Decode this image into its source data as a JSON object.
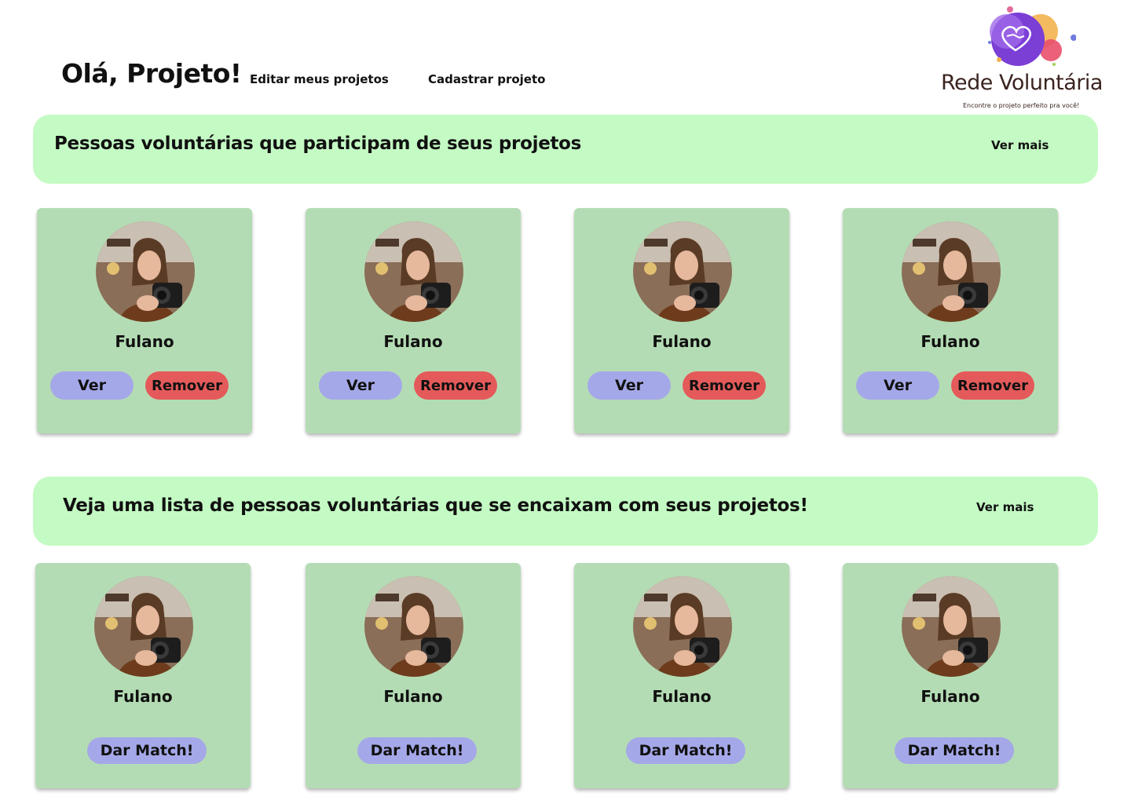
{
  "header": {
    "greeting": "Olá, Projeto!",
    "nav": {
      "edit_projects": "Editar meus projetos",
      "register_project": "Cadastrar projeto"
    }
  },
  "logo": {
    "name": "Rede Voluntária",
    "tagline": "Encontre o projeto perfeito pra você!"
  },
  "participants_section": {
    "title": "Pessoas voluntárias que participam de seus projetos",
    "see_more": "Ver mais",
    "cards": [
      {
        "name": "Fulano",
        "view_label": "Ver",
        "remove_label": "Remover"
      },
      {
        "name": "Fulano",
        "view_label": "Ver",
        "remove_label": "Remover"
      },
      {
        "name": "Fulano",
        "view_label": "Ver",
        "remove_label": "Remover"
      },
      {
        "name": "Fulano",
        "view_label": "Ver",
        "remove_label": "Remover"
      }
    ]
  },
  "matches_section": {
    "title": "Veja uma lista de pessoas voluntárias que se encaixam com seus projetos!",
    "see_more": "Ver mais",
    "cards": [
      {
        "name": "Fulano",
        "match_label": "Dar Match!"
      },
      {
        "name": "Fulano",
        "match_label": "Dar Match!"
      },
      {
        "name": "Fulano",
        "match_label": "Dar Match!"
      },
      {
        "name": "Fulano",
        "match_label": "Dar Match!"
      }
    ]
  },
  "colors": {
    "banner": "#c4fbc4",
    "card": "#b4dcb4",
    "primary_button": "#a5a8e8",
    "danger_button": "#e45a5a"
  },
  "icons": {
    "avatar": "person-photo-icon",
    "logo": "heart-handshake-icon"
  }
}
